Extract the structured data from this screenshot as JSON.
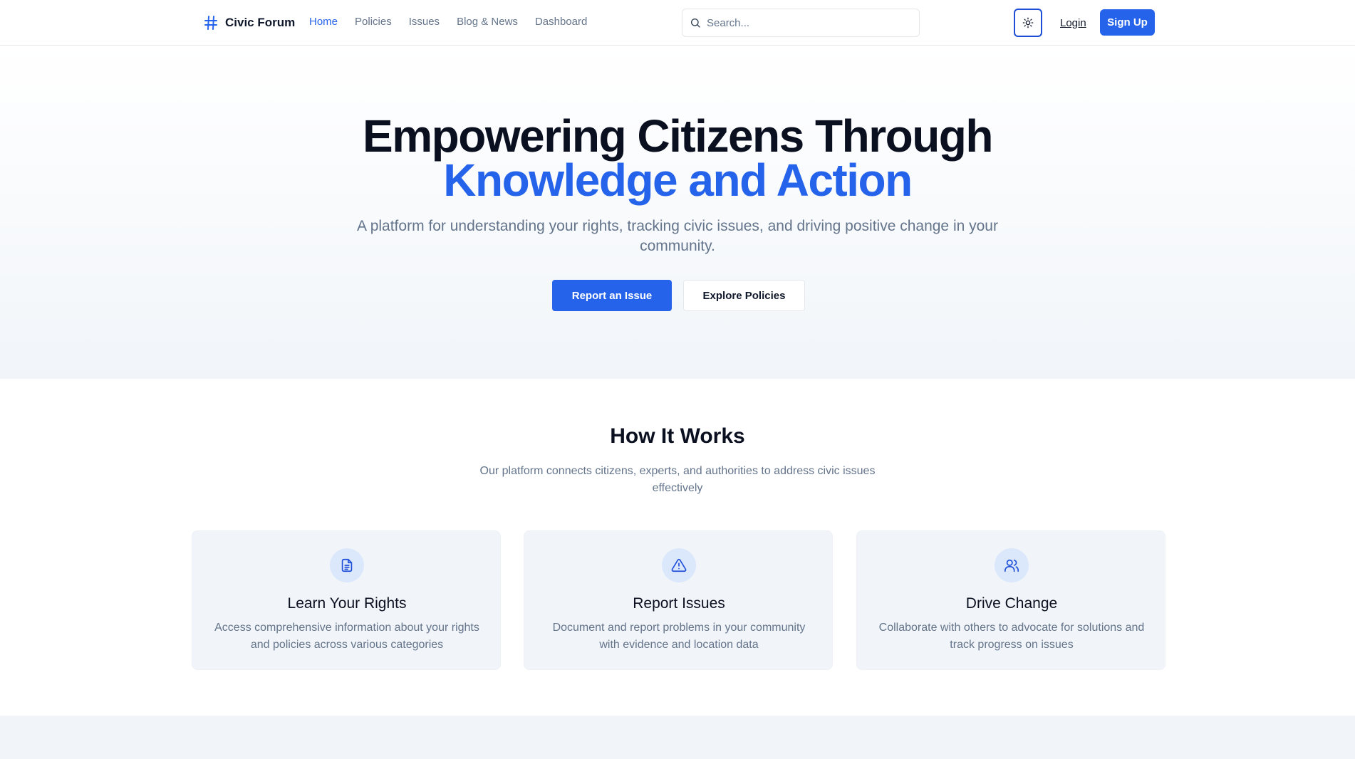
{
  "header": {
    "brand": "Civic Forum",
    "nav": [
      {
        "label": "Home",
        "active": true
      },
      {
        "label": "Policies",
        "active": false
      },
      {
        "label": "Issues",
        "active": false
      },
      {
        "label": "Blog & News",
        "active": false
      },
      {
        "label": "Dashboard",
        "active": false
      }
    ],
    "search_placeholder": "Search...",
    "theme_toggle_icon": "sun-icon",
    "login_label": "Login",
    "signup_label": "Sign Up"
  },
  "hero": {
    "title_line1": "Empowering Citizens Through",
    "title_line2": "Knowledge and Action",
    "subtitle": "A platform for understanding your rights, tracking civic issues, and driving positive change in your community.",
    "primary_cta": "Report an Issue",
    "secondary_cta": "Explore Policies"
  },
  "how_it_works": {
    "title": "How It Works",
    "subtitle": "Our platform connects citizens, experts, and authorities to address civic issues effectively",
    "cards": [
      {
        "icon": "document-icon",
        "title": "Learn Your Rights",
        "text": "Access comprehensive information about your rights and policies across various categories"
      },
      {
        "icon": "warning-icon",
        "title": "Report Issues",
        "text": "Document and report problems in your community with evidence and location data"
      },
      {
        "icon": "users-icon",
        "title": "Drive Change",
        "text": "Collaborate with others to advocate for solutions and track progress on issues"
      }
    ]
  },
  "colors": {
    "accent": "#2563eb",
    "text_dark": "#0b1020",
    "text_muted": "#64748b",
    "card_bg": "#f1f5f9",
    "icon_circle_bg": "#dbe7fb"
  }
}
